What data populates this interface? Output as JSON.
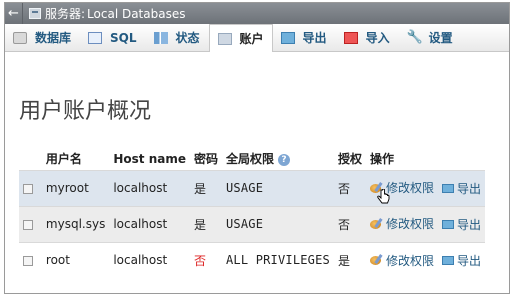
{
  "titlebar": {
    "back_label": "←",
    "server_label": "服务器:",
    "server_name": "Local Databases"
  },
  "tabs": [
    {
      "label": "数据库",
      "icon": "database-icon"
    },
    {
      "label": "SQL",
      "icon": "sql-icon"
    },
    {
      "label": "状态",
      "icon": "status-icon"
    },
    {
      "label": "账户",
      "icon": "accounts-icon",
      "active": true
    },
    {
      "label": "导出",
      "icon": "export-icon"
    },
    {
      "label": "导入",
      "icon": "import-icon"
    },
    {
      "label": "设置",
      "icon": "wrench-icon"
    }
  ],
  "page_title": "用户账户概况",
  "table": {
    "headers": {
      "username": "用户名",
      "hostname": "Host name",
      "password": "密码",
      "global_privileges": "全局权限",
      "grant": "授权",
      "action": "操作"
    },
    "rows": [
      {
        "username": "myroot",
        "host": "localhost",
        "password": "是",
        "privileges": "USAGE",
        "grant": "否",
        "edit": "修改权限",
        "export": "导出"
      },
      {
        "username": "mysql.sys",
        "host": "localhost",
        "password": "是",
        "privileges": "USAGE",
        "grant": "否",
        "edit": "修改权限",
        "export": "导出"
      },
      {
        "username": "root",
        "host": "localhost",
        "password": "否",
        "privileges": "ALL PRIVILEGES",
        "grant": "是",
        "edit": "修改权限",
        "export": "导出"
      }
    ]
  },
  "colors": {
    "link": "#235a81",
    "row_highlight": "#dde5ee",
    "no_password": "#dd2222"
  }
}
